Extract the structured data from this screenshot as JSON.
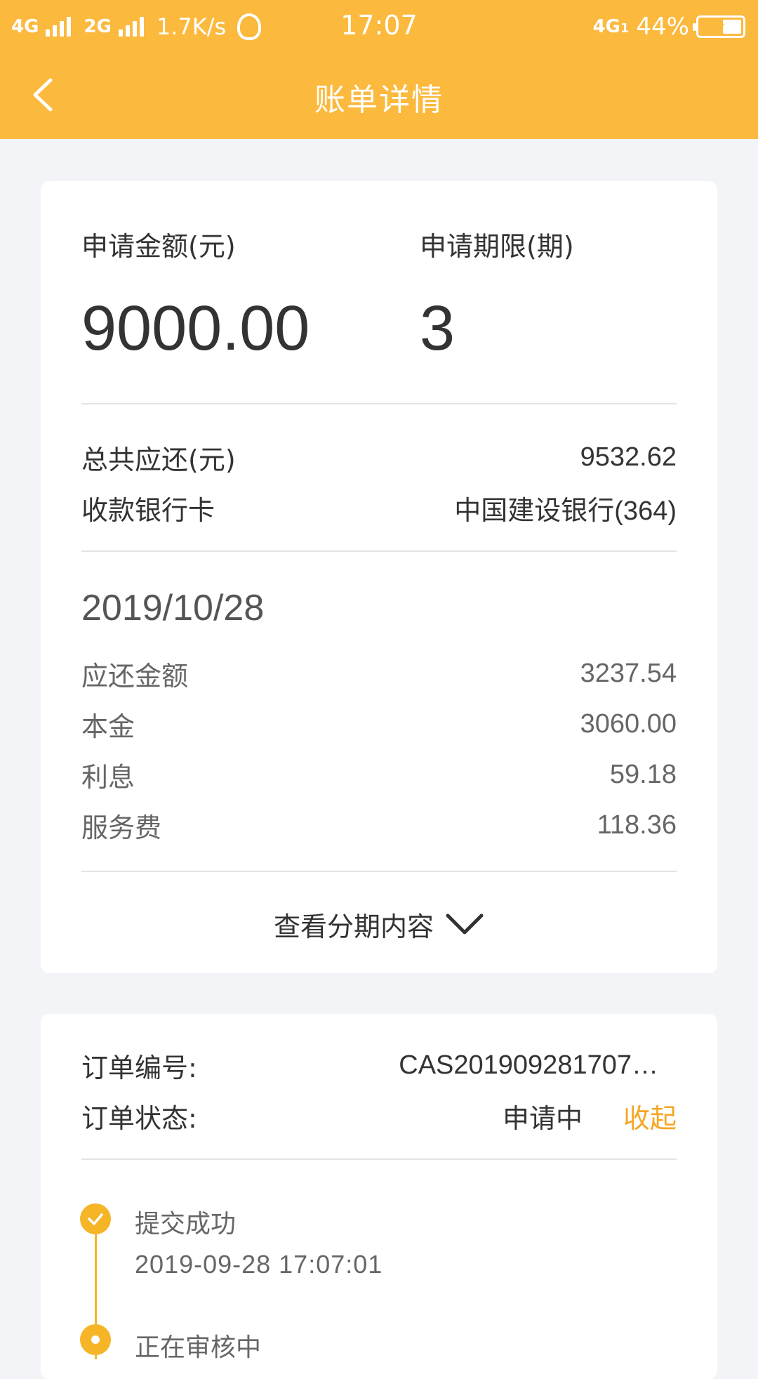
{
  "status_bar": {
    "network1": "4G",
    "network2": "2G",
    "speed": "1.7K/s",
    "time": "17:07",
    "network_right": "4G",
    "network_right_sub": "1",
    "battery": "44%",
    "battery_level": 0.44
  },
  "nav": {
    "title": "账单详情"
  },
  "summary": {
    "amount_label": "申请金额(元)",
    "amount_value": "9000.00",
    "term_label": "申请期限(期)",
    "term_value": "3",
    "total_label": "总共应还(元)",
    "total_value": "9532.62",
    "bank_label": "收款银行卡",
    "bank_value": "中国建设银行(364)"
  },
  "installment": {
    "date": "2019/10/28",
    "rows": [
      {
        "label": "应还金额",
        "value": "3237.54"
      },
      {
        "label": "本金",
        "value": "3060.00"
      },
      {
        "label": "利息",
        "value": "59.18"
      },
      {
        "label": "服务费",
        "value": "118.36"
      }
    ],
    "expand_label": "查看分期内容"
  },
  "order": {
    "number_label": "订单编号:",
    "number_value": "CAS201909281707…",
    "status_label": "订单状态:",
    "status_value": "申请中",
    "collapse_label": "收起"
  },
  "timeline": [
    {
      "title": "提交成功",
      "time": "2019-09-28 17:07:01"
    },
    {
      "title": "正在审核中",
      "time": ""
    }
  ],
  "colors": {
    "accent": "#fbb93d",
    "timeline": "#f5b526",
    "link": "#f5a623"
  }
}
